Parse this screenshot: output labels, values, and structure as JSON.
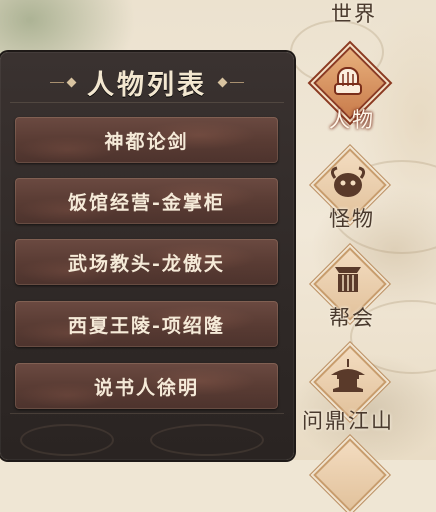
{
  "panel": {
    "title": "人物列表",
    "items": [
      {
        "label": "神都论剑"
      },
      {
        "label": "饭馆经营-金掌柜"
      },
      {
        "label": "武场教头-龙傲天"
      },
      {
        "label": "西夏王陵-项绍隆"
      },
      {
        "label": "说书人徐明"
      }
    ]
  },
  "side_menu": {
    "items": [
      {
        "label": "世界",
        "icon": "world-icon",
        "active": false
      },
      {
        "label": "人物",
        "icon": "person-icon",
        "active": true
      },
      {
        "label": "怪物",
        "icon": "monster-icon",
        "active": false
      },
      {
        "label": "帮会",
        "icon": "guild-icon",
        "active": false
      },
      {
        "label": "问鼎江山",
        "icon": "pavilion-icon",
        "active": false
      }
    ]
  },
  "colors": {
    "panel_bg": "#2f2927",
    "item_bg": "#5a3c34",
    "item_text": "#f5ead8",
    "active_accent": "#8b3a22",
    "menu_text": "#4a3a2e"
  }
}
